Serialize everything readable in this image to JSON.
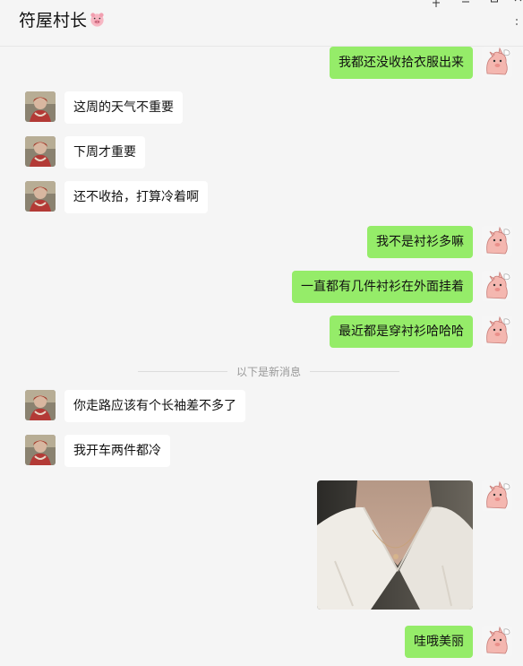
{
  "header": {
    "title": "符屋村长",
    "window_controls": {
      "pin": "pin-icon",
      "minimize": "minimize-icon",
      "maximize": "maximize-icon",
      "close": "close-icon"
    }
  },
  "messages": [
    {
      "from": "me",
      "text": "我都还没收拾衣服出来"
    },
    {
      "from": "other",
      "text": "这周的天气不重要"
    },
    {
      "from": "other",
      "text": "下周才重要"
    },
    {
      "from": "other",
      "text": "还不收拾，打算冷着啊"
    },
    {
      "from": "me",
      "text": "我不是衬衫多嘛"
    },
    {
      "from": "me",
      "text": "一直都有几件衬衫在外面挂着"
    },
    {
      "from": "me",
      "text": "最近都是穿衬衫哈哈哈"
    },
    {
      "from": "other",
      "text": "你走路应该有个长袖差不多了"
    },
    {
      "from": "other",
      "text": "我开车两件都冷"
    },
    {
      "from": "me",
      "type": "image",
      "icon": "photo-necklace"
    },
    {
      "from": "me",
      "text": "哇哦美丽"
    }
  ],
  "divider": {
    "text": "以下是新消息"
  },
  "colors": {
    "background": "#f5f5f5",
    "outgoing_bubble": "#95ec69",
    "incoming_bubble": "#ffffff",
    "divider_text": "#999999"
  }
}
